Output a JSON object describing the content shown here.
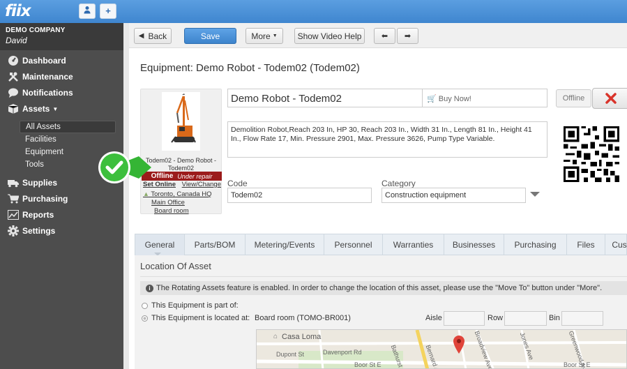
{
  "app": {
    "logo": "fiix"
  },
  "topbar": {
    "user_icon": "person-icon",
    "add_icon": "plus-icon"
  },
  "sidebar": {
    "company": "DEMO COMPANY",
    "user": "David",
    "items": [
      {
        "label": "Dashboard",
        "icon": "dashboard-icon"
      },
      {
        "label": "Maintenance",
        "icon": "tools-icon"
      },
      {
        "label": "Notifications",
        "icon": "chat-icon"
      },
      {
        "label": "Assets",
        "icon": "box-icon"
      },
      {
        "label": "Supplies",
        "icon": "truck-icon"
      },
      {
        "label": "Purchasing",
        "icon": "cart-icon"
      },
      {
        "label": "Reports",
        "icon": "chart-icon"
      },
      {
        "label": "Settings",
        "icon": "gear-icon"
      }
    ],
    "asset_sub": [
      "All Assets",
      "Facilities",
      "Equipment",
      "Tools"
    ]
  },
  "toolbar": {
    "back": "Back",
    "save": "Save",
    "more": "More",
    "video": "Show Video Help"
  },
  "page": {
    "title": "Equipment: Demo Robot - Todem02 (Todem02)"
  },
  "asset": {
    "caption": "Todem02 - Demo Robot - Todem02",
    "status": "Offline",
    "status_sub": "Under repair",
    "set_online": "Set Online",
    "view_change": "View/Change",
    "locations": [
      "Toronto, Canada HQ",
      "Main Office",
      "Board room"
    ],
    "name": "Demo Robot - Todem02",
    "buy_now": "Buy Now!",
    "offline_btn": "Offline",
    "description": "Demolition Robot,Reach 203 In, HP 30, Reach 203 In., Width 31 In., Length 81 In., Height 41 In., Flow Rate 17, Min. Pressure 2901, Max. Pressure 3626, Pump Type Variable.",
    "code_label": "Code",
    "code_value": "Todem02",
    "category_label": "Category",
    "category_value": "Construction equipment"
  },
  "tabs": [
    "General",
    "Parts/BOM",
    "Metering/Events",
    "Personnel",
    "Warranties",
    "Businesses",
    "Purchasing",
    "Files",
    "Cus"
  ],
  "location": {
    "title": "Location Of Asset",
    "info": "The Rotating Assets feature is enabled. In order to change the location of this asset, please use the \"Move To\" button under \"More\".",
    "part_of": "This Equipment is part of:",
    "located_at": "This Equipment is located at:",
    "located_value": "Board room (TOMO-BR001)",
    "aisle": "Aisle",
    "row": "Row",
    "bin": "Bin"
  },
  "map": {
    "labels": [
      "Casa Loma",
      "Dupont St",
      "Davenport Rd",
      "Bathurst St",
      "Bernard Ave",
      "Broadview Ave",
      "Jones Ave",
      "Greenwood Ave",
      "Boor St E",
      "Boor St E"
    ]
  },
  "colors": {
    "brand": "#4a90d9",
    "sidebar": "#4d4d4d",
    "status_offline": "#9b1b1b",
    "badge_green": "#3fbf3f"
  }
}
